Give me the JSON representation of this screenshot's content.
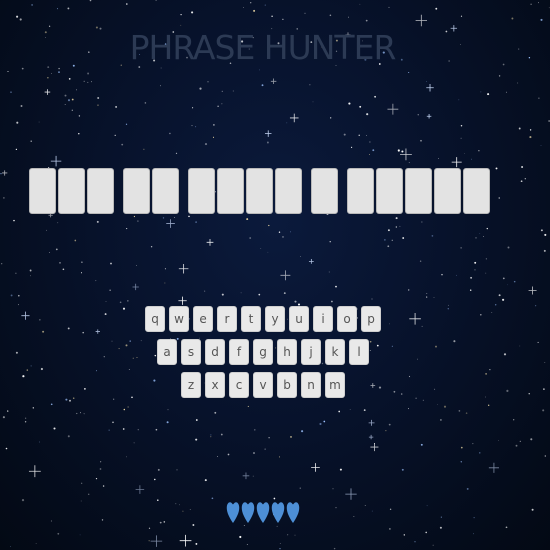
{
  "game": {
    "title": "PHRASE HUNTER"
  },
  "phrase": {
    "words": [
      3,
      2,
      4,
      1,
      5
    ]
  },
  "keyboard": {
    "rows": [
      [
        "q",
        "w",
        "e",
        "r",
        "t",
        "y",
        "u",
        "i",
        "o",
        "p"
      ],
      [
        "a",
        "s",
        "d",
        "f",
        "g",
        "h",
        "j",
        "k",
        "l"
      ],
      [
        "z",
        "x",
        "c",
        "v",
        "b",
        "n",
        "m"
      ]
    ]
  },
  "lives": {
    "remaining": 5,
    "icon": "heart-icon",
    "color": "#4d8fd6"
  },
  "colors": {
    "background": "#07122b",
    "title": "#2c3a54",
    "tile": "#e3e3e3",
    "key": "#e9e9e9"
  }
}
